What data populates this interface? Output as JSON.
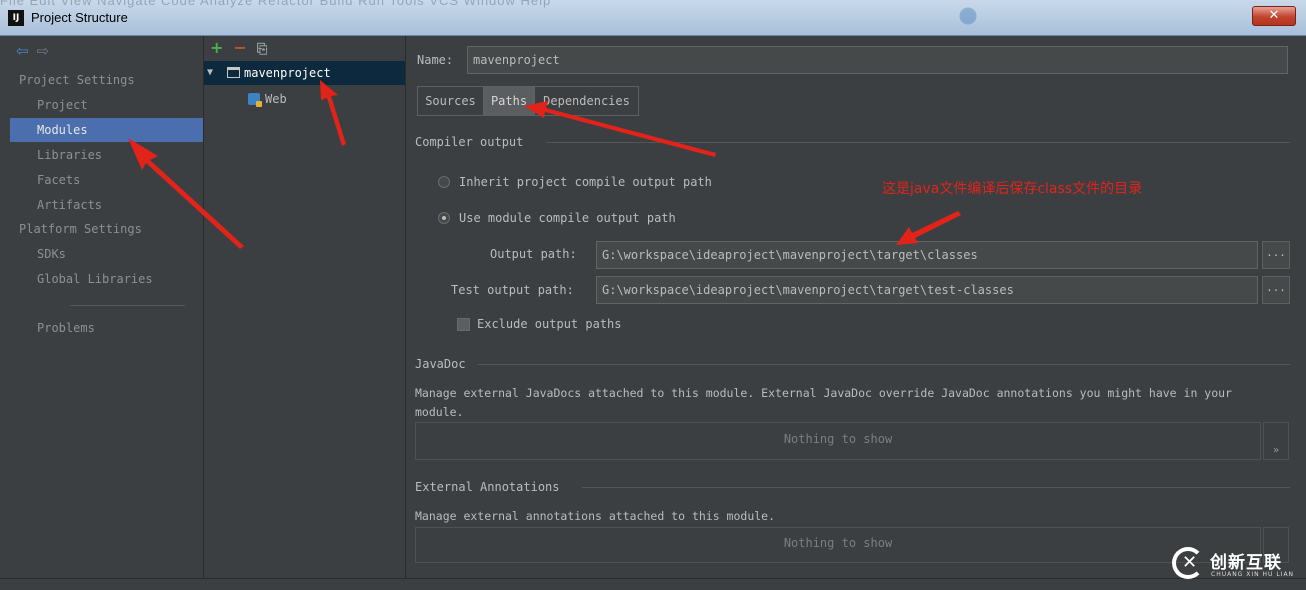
{
  "window": {
    "menubar_ghost": "File  Edit  View  Navigate  Code  Analyze  Refactor  Build  Run  Tools  VCS  Window  Help",
    "title": "Project Structure",
    "app_icon": "IJ",
    "close_glyph": "✕"
  },
  "nav": {
    "back_glyph": "⇦",
    "forward_glyph": "⇨",
    "project_settings_header": "Project Settings",
    "items_project": [
      "Project",
      "Modules",
      "Libraries",
      "Facets",
      "Artifacts"
    ],
    "platform_settings_header": "Platform Settings",
    "items_platform": [
      "SDKs",
      "Global Libraries"
    ],
    "problems": "Problems",
    "selected": "Modules"
  },
  "tree": {
    "add_glyph": "+",
    "remove_glyph": "−",
    "copy_glyph": "⎘",
    "expand_glyph": "▼",
    "root": "mavenproject",
    "child": "Web"
  },
  "module": {
    "name_label": "Name:",
    "name_value": "mavenproject",
    "tabs": [
      "Sources",
      "Paths",
      "Dependencies"
    ],
    "selected_tab": "Paths",
    "compiler_output_title": "Compiler output",
    "inherit_label": "Inherit project compile output path",
    "use_module_label": "Use module compile output path",
    "output_path_label": "Output path:",
    "output_path_value": "G:\\workspace\\ideaproject\\mavenproject\\target\\classes",
    "test_output_path_label": "Test output path:",
    "test_output_path_value": "G:\\workspace\\ideaproject\\mavenproject\\target\\test-classes",
    "browse_glyph": "...",
    "exclude_label": "Exclude output paths",
    "javadoc_title": "JavaDoc",
    "javadoc_desc_line1": "Manage external JavaDocs attached to this module. External JavaDoc override JavaDoc annotations you might have in your",
    "javadoc_desc_line2": "module.",
    "nothing_to_show": "Nothing to show",
    "side_glyph": "»",
    "external_annotations_title": "External Annotations",
    "external_annotations_desc": "Manage external annotations attached to this module."
  },
  "annotation": {
    "text": "这是java文件编译后保存class文件的目录",
    "color": "#e2231a"
  },
  "watermark": {
    "cn": "创新互联",
    "en": "CHUANG XIN HU LIAN"
  },
  "colors": {
    "background": "#3c3f41",
    "selection": "#4b6eaf",
    "tree_selection": "#0d293e",
    "arrow": "#e2231a"
  }
}
